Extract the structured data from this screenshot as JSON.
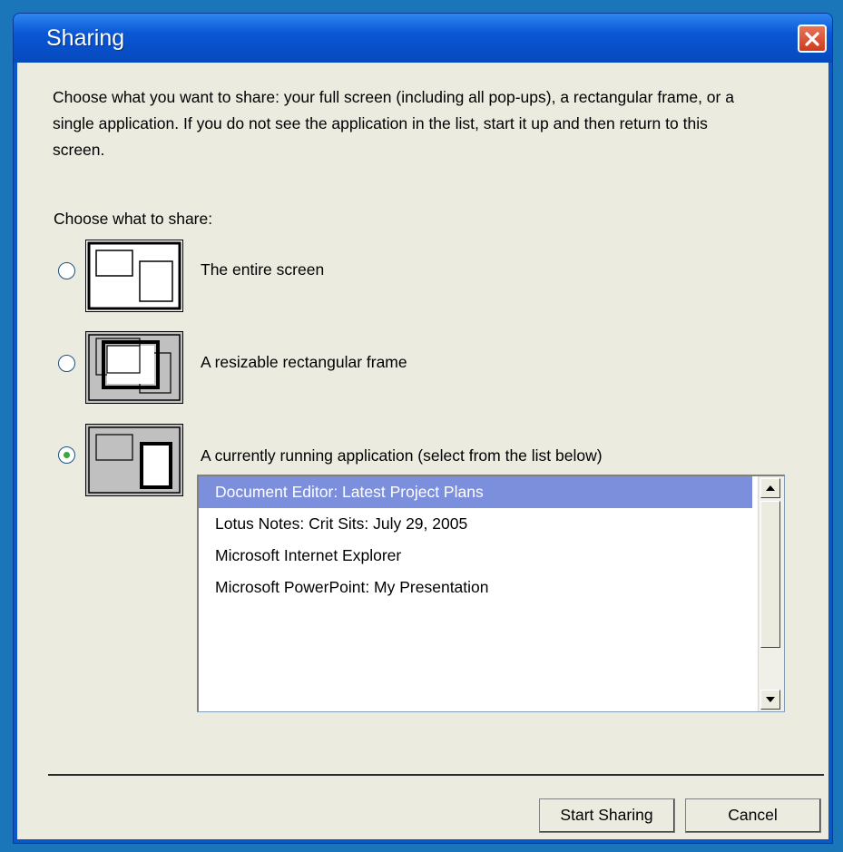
{
  "window": {
    "title": "Sharing"
  },
  "description": "Choose what you want to share: your full screen (including all pop-ups), a rectangular frame, or a single application.  If you do not see the application in the list, start it up and then return to this screen.",
  "choose_label": "Choose what to share:",
  "options": [
    {
      "label": "The entire screen",
      "selected": false
    },
    {
      "label": "A resizable rectangular frame",
      "selected": false
    },
    {
      "label": "A currently running application (select from the list below)",
      "selected": true
    }
  ],
  "applications": [
    {
      "label": "Document Editor: Latest Project Plans",
      "selected": true
    },
    {
      "label": "Lotus Notes: Crit Sits: July 29, 2005",
      "selected": false
    },
    {
      "label": "Microsoft Internet Explorer",
      "selected": false
    },
    {
      "label": "Microsoft PowerPoint: My Presentation",
      "selected": false
    }
  ],
  "buttons": {
    "start": "Start Sharing",
    "cancel": "Cancel"
  },
  "icons": {
    "close": "close-icon",
    "scroll_up": "scroll-up-arrow-icon",
    "scroll_down": "scroll-down-arrow-icon"
  },
  "colors": {
    "title_bar": "#0a57d6",
    "dialog_bg": "#ecebe0",
    "selection": "#7b8fdc",
    "close_button": "#cf3a1c"
  }
}
